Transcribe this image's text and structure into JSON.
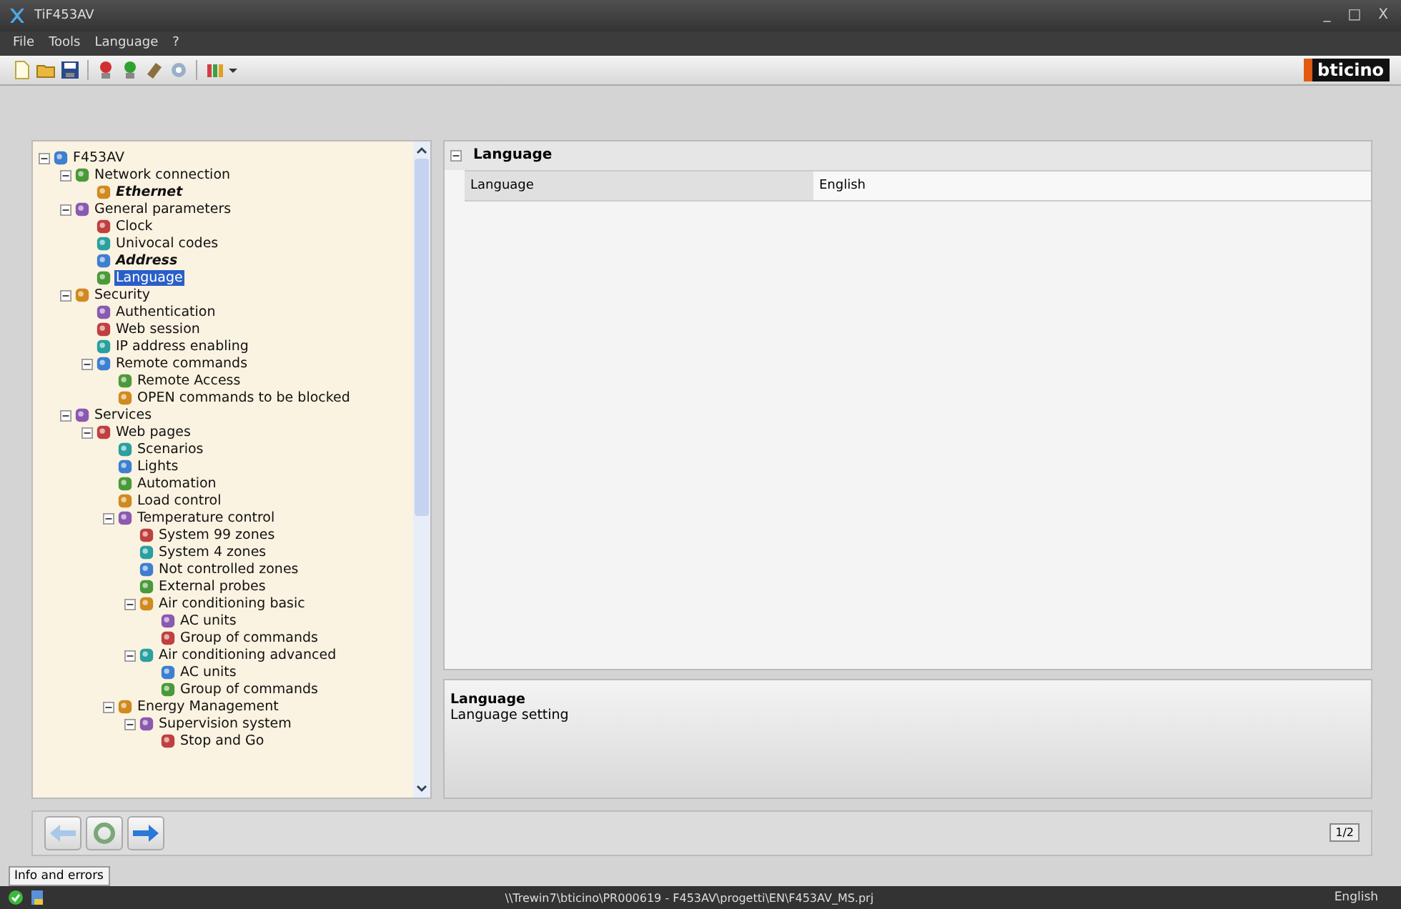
{
  "window": {
    "title": "TiF453AV",
    "controls": [
      "_",
      "□",
      "X"
    ]
  },
  "menu": [
    "File",
    "Tools",
    "Language",
    "?"
  ],
  "toolbar": {
    "logo": "bticino"
  },
  "tree": [
    {
      "label": "F453AV",
      "bold": false,
      "selected": false,
      "expanded": true,
      "children": [
        {
          "label": "Network connection",
          "bold": false,
          "selected": false,
          "expanded": true,
          "children": [
            {
              "label": "Ethernet",
              "bold": true,
              "selected": false
            }
          ]
        },
        {
          "label": "General parameters",
          "bold": false,
          "selected": false,
          "expanded": true,
          "children": [
            {
              "label": "Clock",
              "bold": false,
              "selected": false
            },
            {
              "label": "Univocal codes",
              "bold": false,
              "selected": false
            },
            {
              "label": "Address",
              "bold": true,
              "selected": false
            },
            {
              "label": "Language",
              "bold": false,
              "selected": true
            }
          ]
        },
        {
          "label": "Security",
          "bold": false,
          "selected": false,
          "expanded": true,
          "children": [
            {
              "label": "Authentication",
              "bold": false,
              "selected": false
            },
            {
              "label": "Web session",
              "bold": false,
              "selected": false
            },
            {
              "label": "IP address enabling",
              "bold": false,
              "selected": false
            },
            {
              "label": "Remote commands",
              "bold": false,
              "selected": false,
              "expanded": true,
              "children": [
                {
                  "label": "Remote Access",
                  "bold": false,
                  "selected": false
                },
                {
                  "label": "OPEN commands to be blocked",
                  "bold": false,
                  "selected": false
                }
              ]
            }
          ]
        },
        {
          "label": "Services",
          "bold": false,
          "selected": false,
          "expanded": true,
          "children": [
            {
              "label": "Web pages",
              "bold": false,
              "selected": false,
              "expanded": true,
              "children": [
                {
                  "label": "Scenarios",
                  "bold": false,
                  "selected": false
                },
                {
                  "label": "Lights",
                  "bold": false,
                  "selected": false
                },
                {
                  "label": "Automation",
                  "bold": false,
                  "selected": false
                },
                {
                  "label": "Load control",
                  "bold": false,
                  "selected": false
                },
                {
                  "label": "Temperature control",
                  "bold": false,
                  "selected": false,
                  "expanded": true,
                  "children": [
                    {
                      "label": "System 99 zones",
                      "bold": false,
                      "selected": false
                    },
                    {
                      "label": "System 4 zones",
                      "bold": false,
                      "selected": false
                    },
                    {
                      "label": "Not controlled zones",
                      "bold": false,
                      "selected": false
                    },
                    {
                      "label": "External probes",
                      "bold": false,
                      "selected": false
                    },
                    {
                      "label": "Air conditioning basic",
                      "bold": false,
                      "selected": false,
                      "expanded": true,
                      "children": [
                        {
                          "label": "AC units",
                          "bold": false,
                          "selected": false
                        },
                        {
                          "label": "Group of commands",
                          "bold": false,
                          "selected": false
                        }
                      ]
                    },
                    {
                      "label": "Air conditioning advanced",
                      "bold": false,
                      "selected": false,
                      "expanded": true,
                      "children": [
                        {
                          "label": "AC units",
                          "bold": false,
                          "selected": false
                        },
                        {
                          "label": "Group of commands",
                          "bold": false,
                          "selected": false
                        }
                      ]
                    }
                  ]
                },
                {
                  "label": "Energy Management",
                  "bold": false,
                  "selected": false,
                  "expanded": true,
                  "children": [
                    {
                      "label": "Supervision system",
                      "bold": false,
                      "selected": false,
                      "expanded": true,
                      "children": [
                        {
                          "label": "Stop and Go",
                          "bold": false,
                          "selected": false
                        }
                      ]
                    }
                  ]
                }
              ]
            }
          ]
        }
      ]
    }
  ],
  "properties": {
    "section": "Language",
    "expanded": true,
    "rows": [
      {
        "name": "Language",
        "value": "English"
      }
    ]
  },
  "description": {
    "title": "Language",
    "text": "Language setting"
  },
  "navigation": {
    "page": "1/2"
  },
  "info_tab": "Info and errors",
  "status_bar": {
    "path": "\\\\Trewin7\\bticino\\PR000619 - F453AV\\progetti\\EN\\F453AV_MS.prj",
    "language": "English"
  }
}
